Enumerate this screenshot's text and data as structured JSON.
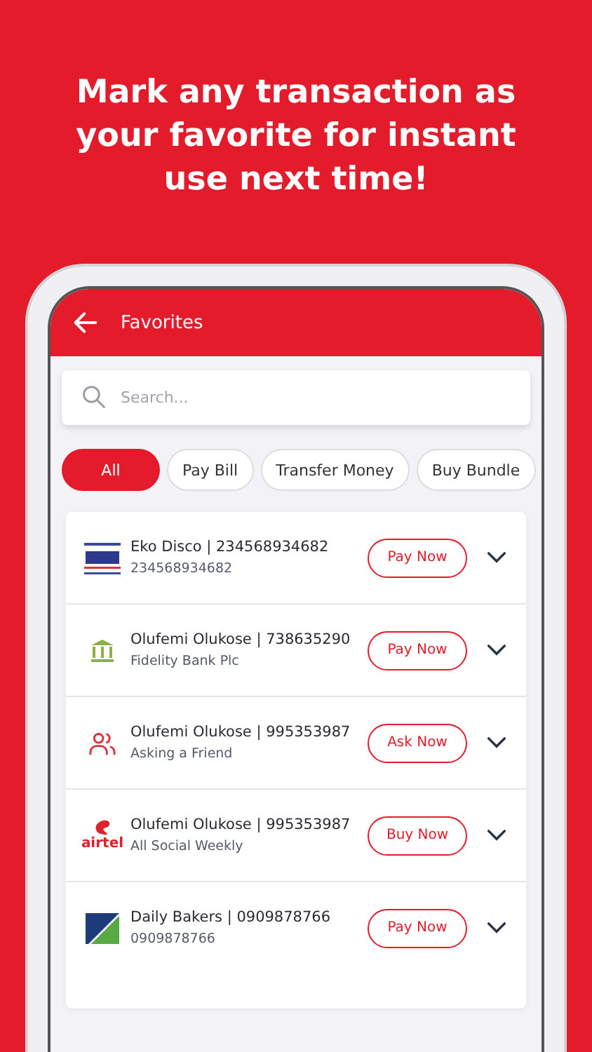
{
  "headline": "Mark any transaction as your favorite for instant use next time!",
  "app_bar": {
    "title": "Favorites"
  },
  "search": {
    "placeholder": "Search..."
  },
  "filters": [
    {
      "label": "All",
      "selected": true
    },
    {
      "label": "Pay Bill",
      "selected": false
    },
    {
      "label": "Transfer Money",
      "selected": false
    },
    {
      "label": "Buy Bundle",
      "selected": false
    }
  ],
  "favorites": [
    {
      "kind": "eko",
      "title": "Eko Disco | 234568934682",
      "subtitle": "234568934682",
      "action": "Pay Now"
    },
    {
      "kind": "bank",
      "title": "Olufemi Olukose | 738635290",
      "subtitle": "Fidelity Bank Plc",
      "action": "Pay Now"
    },
    {
      "kind": "people",
      "title": "Olufemi Olukose | 995353987",
      "subtitle": "Asking a Friend",
      "action": "Ask Now"
    },
    {
      "kind": "airtel",
      "logo_text": "airtel",
      "title": "Olufemi Olukose | 995353987",
      "subtitle": "All Social Weekly",
      "action": "Buy Now"
    },
    {
      "kind": "bakers",
      "title": "Daily Bakers | 0909878766",
      "subtitle": "0909878766",
      "action": "Pay Now"
    }
  ]
}
